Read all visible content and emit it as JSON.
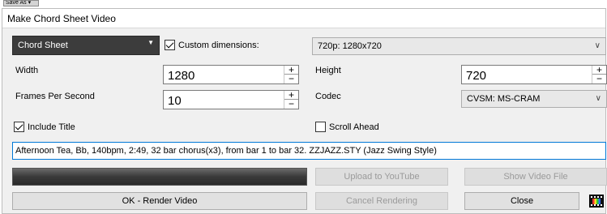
{
  "save_as": {
    "label": "Save As ▾"
  },
  "dialog": {
    "title": "Make Chord Sheet Video"
  },
  "source": {
    "selected": "Chord Sheet"
  },
  "custom_dimensions": {
    "label": "Custom dimensions:",
    "checked": true
  },
  "resolution": {
    "selected": "720p: 1280x720"
  },
  "width": {
    "label": "Width",
    "value": "1280"
  },
  "height": {
    "label": "Height",
    "value": "720"
  },
  "fps": {
    "label": "Frames Per Second",
    "value": "10"
  },
  "codec": {
    "label": "Codec",
    "selected": "CVSM: MS-CRAM"
  },
  "include_title": {
    "label": "Include Title",
    "checked": true
  },
  "scroll_ahead": {
    "label": "Scroll Ahead",
    "checked": false
  },
  "title_text": {
    "value": "Afternoon Tea, Bb, 140bpm, 2:49, 32 bar chorus(x3), from bar 1 to bar 32. ZZJAZZ.STY (Jazz Swing Style)"
  },
  "buttons": {
    "upload": "Upload to YouTube",
    "show_file": "Show Video File",
    "render": "OK - Render Video",
    "cancel": "Cancel Rendering",
    "close": "Close"
  },
  "icons": {
    "film": "film-strip-icon",
    "dropdown": "chevron-down-icon",
    "spin_plus": "+",
    "spin_minus": "−"
  }
}
